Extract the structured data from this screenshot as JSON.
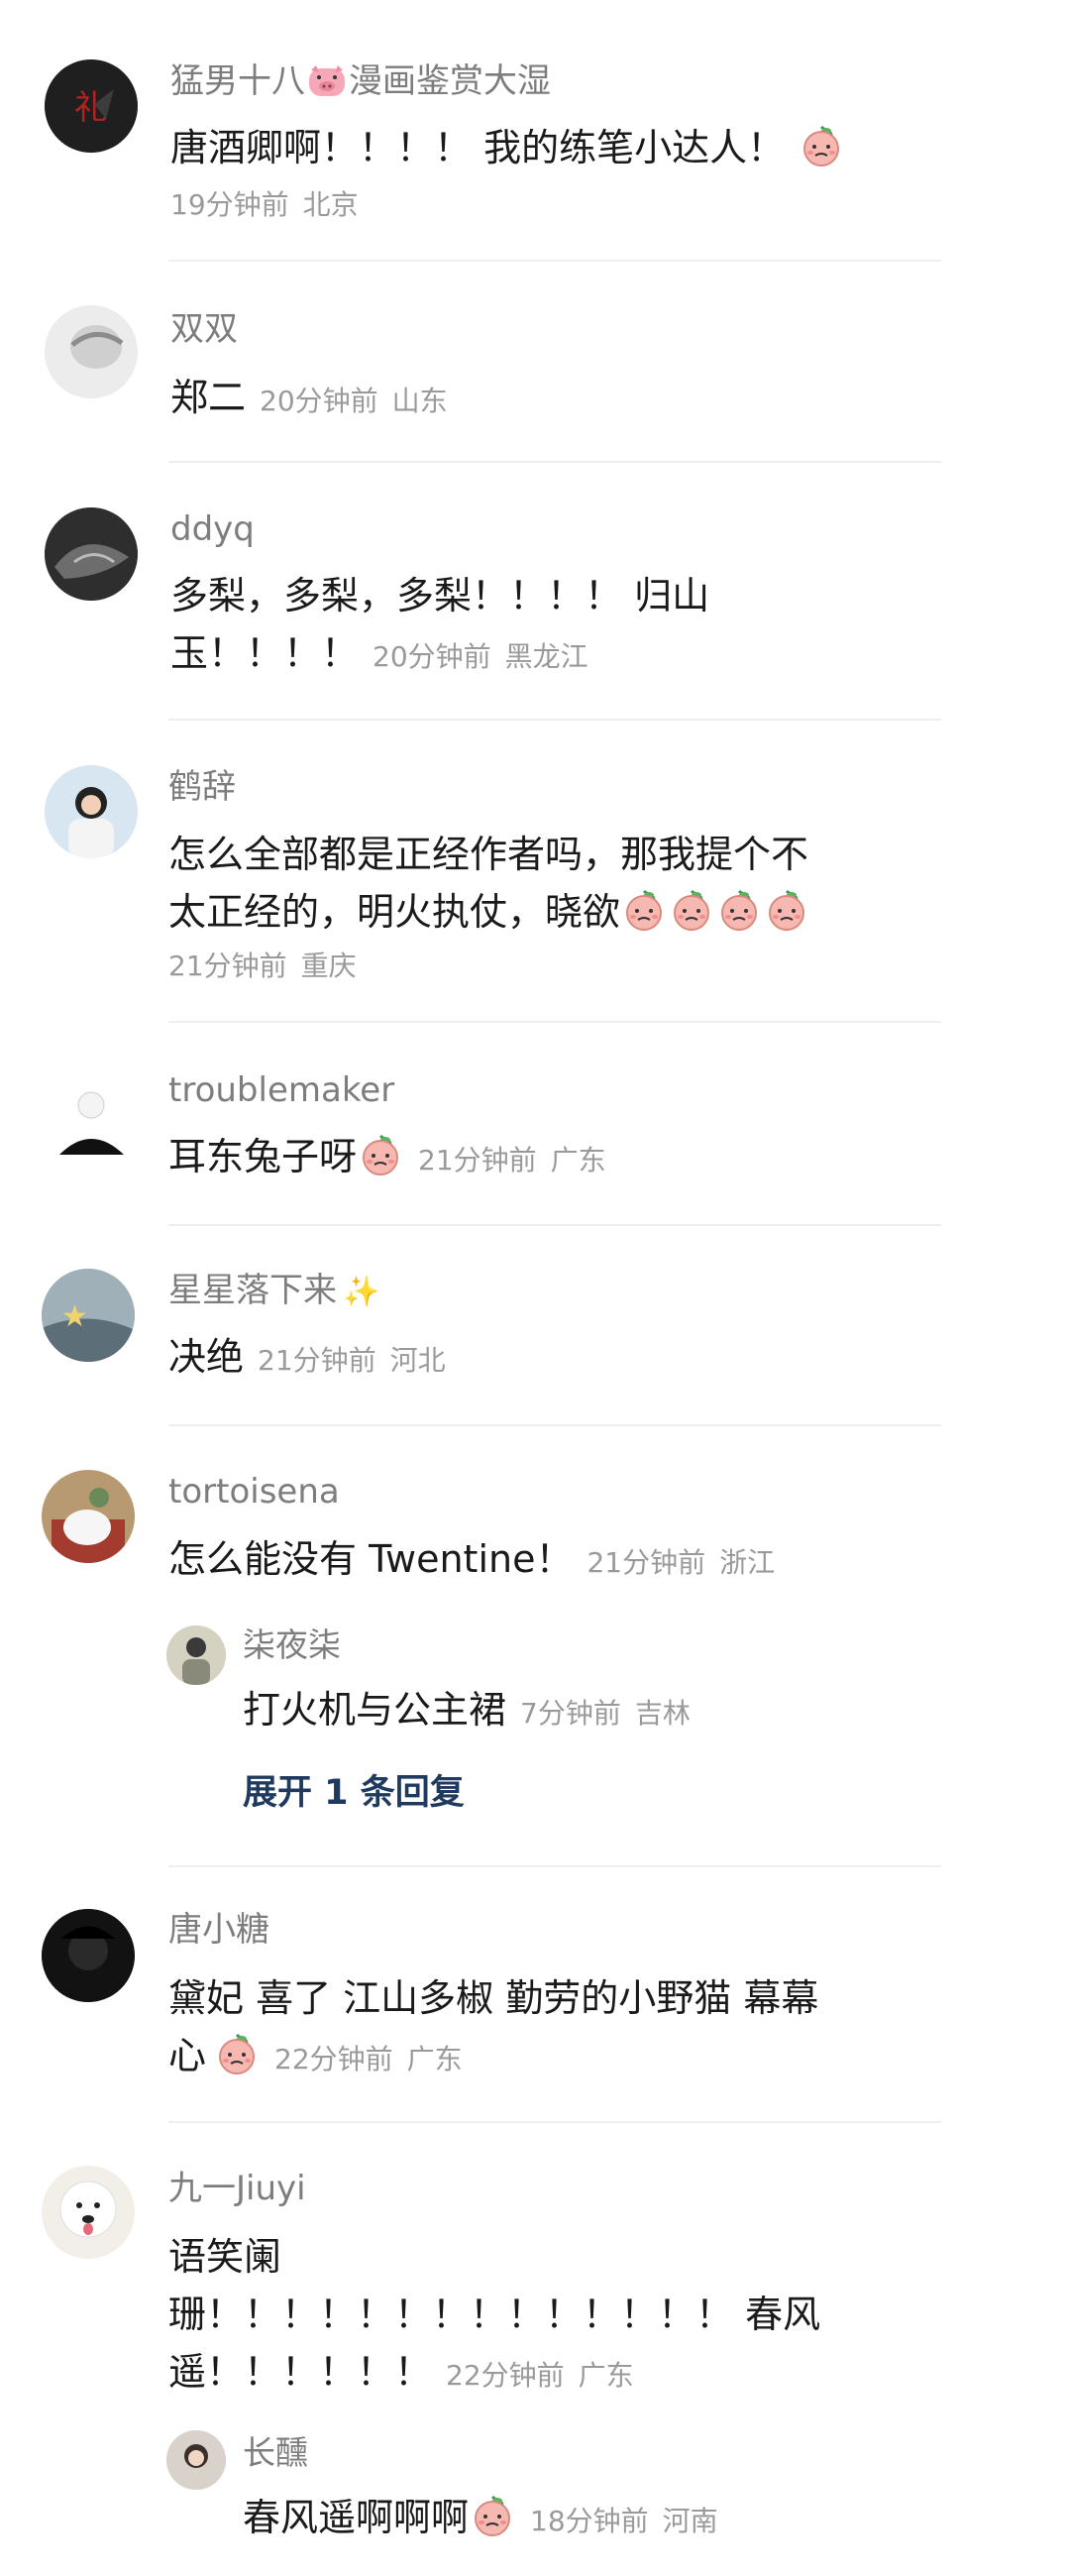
{
  "comments": [
    {
      "user": "猛男十八",
      "user_tail": "漫画鉴赏大湿",
      "text": "唐酒卿啊！！！！ 我的练笔小达人！",
      "time": "19分钟前",
      "loc": "北京"
    },
    {
      "user": "双双",
      "text": "郑二",
      "time": "20分钟前",
      "loc": "山东"
    },
    {
      "user": "ddyq",
      "text_line1": "多梨，多梨，多梨！！！！ 归山",
      "text_line2": "玉！！！！",
      "time": "20分钟前",
      "loc": "黑龙江"
    },
    {
      "user": "鹤辞",
      "text_line1": "怎么全部都是正经作者吗，那我提个不",
      "text_line2": "太正经的，明火执仗，晓欲",
      "time": "21分钟前",
      "loc": "重庆"
    },
    {
      "user": "troublemaker",
      "text": "耳东兔子呀",
      "time": "21分钟前",
      "loc": "广东"
    },
    {
      "user": "星星落下来",
      "text": "决绝",
      "time": "21分钟前",
      "loc": "河北"
    },
    {
      "user": "tortoisena",
      "text": "怎么能没有 Twentine！",
      "time": "21分钟前",
      "loc": "浙江",
      "reply": {
        "user": "柒夜柒",
        "text": "打火机与公主裙",
        "time": "7分钟前",
        "loc": "吉林"
      },
      "expand": "展开 1 条回复"
    },
    {
      "user": "唐小糖",
      "text_line1": "黛妃 喜了 江山多椒 勤劳的小野猫 幕幕",
      "text_line2": "心",
      "time": "22分钟前",
      "loc": "广东"
    },
    {
      "user": "九一Jiuyi",
      "text_line1": "语笑阑",
      "text_line2": "珊！！！！！！！！！！！！！！ 春风",
      "text_line3": "遥！！！！！！",
      "time": "22分钟前",
      "loc": "广东",
      "reply": {
        "user": "长醺",
        "text": "春风遥啊啊啊",
        "time": "18分钟前",
        "loc": "河南"
      }
    }
  ],
  "icons": {
    "pig": "pig-emoji-icon",
    "peach": "peach-face-emoji-icon",
    "sparkle": "sparkle-emoji-icon"
  },
  "colors": {
    "name": "#7d7d7d",
    "text": "#1a1a1a",
    "meta": "#9a9a9a",
    "expand": "#1f3a5f",
    "divider": "#eeeeee"
  }
}
